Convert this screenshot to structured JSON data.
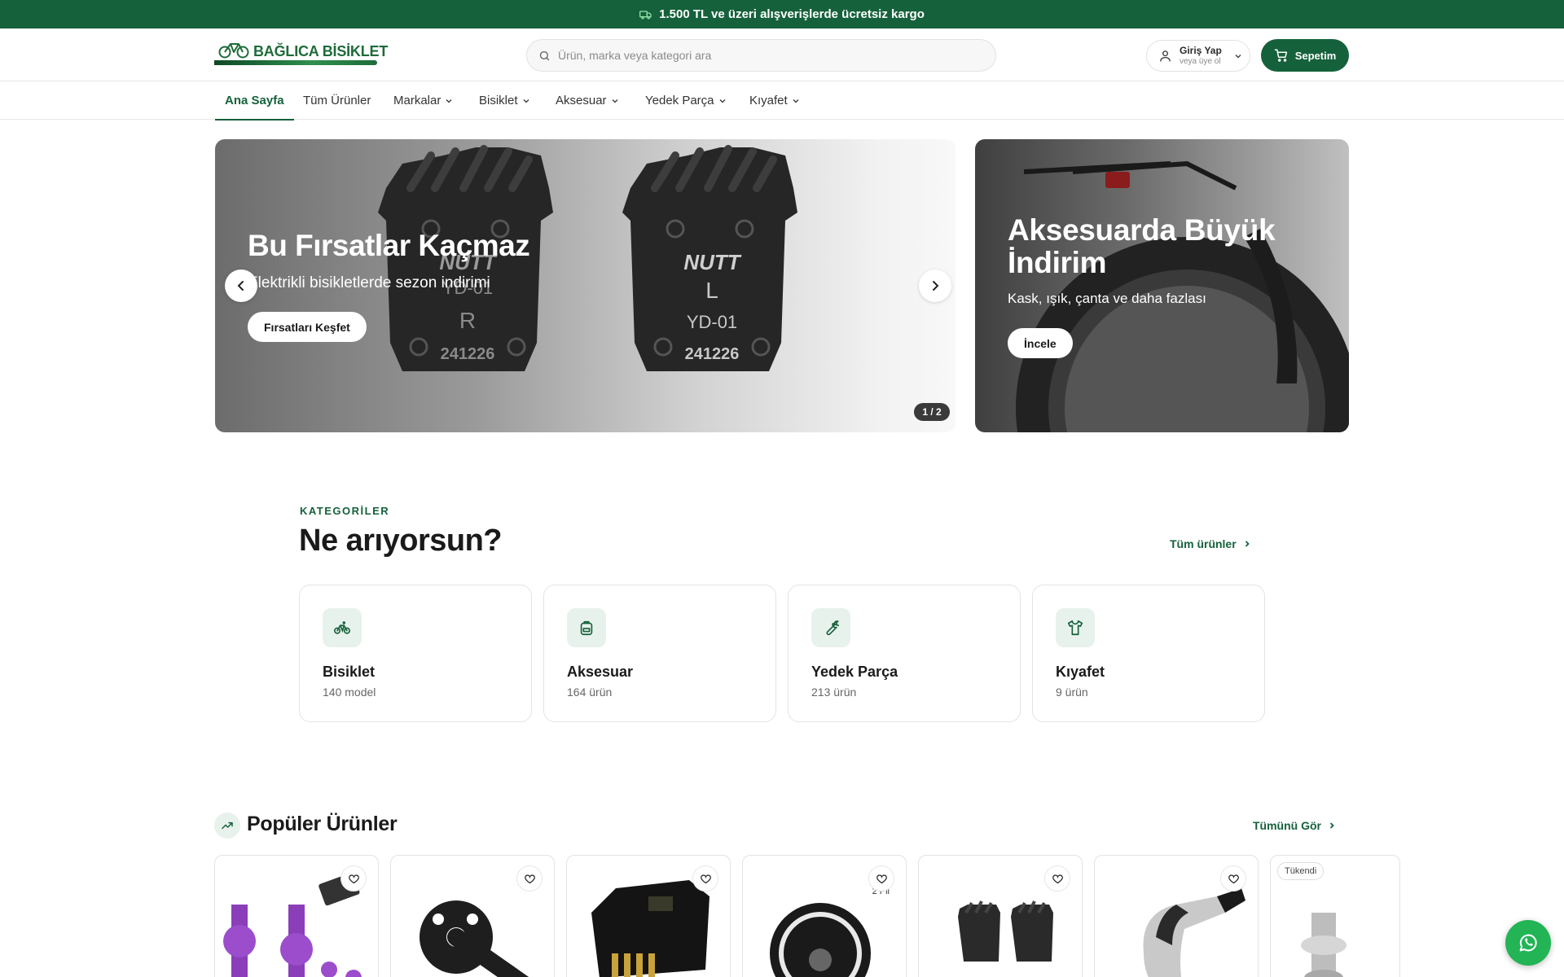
{
  "announcement": {
    "text": "1.500 TL ve üzeri alışverişlerde ücretsiz kargo",
    "icon": "truck-icon"
  },
  "header": {
    "logo_text": "BAĞLICA BİSİKLET",
    "search_placeholder": "Ürün, marka veya kategori ara",
    "login_label": "Giriş Yap",
    "login_sub": "veya üye ol",
    "cart_label": "Sepetim"
  },
  "nav": {
    "items": [
      {
        "label": "Ana Sayfa",
        "active": true,
        "dropdown": false
      },
      {
        "label": "Tüm Ürünler",
        "active": false,
        "dropdown": false
      },
      {
        "label": "Markalar",
        "active": false,
        "dropdown": true
      },
      {
        "label": "Bisiklet",
        "active": false,
        "dropdown": true
      },
      {
        "label": "Aksesuar",
        "active": false,
        "dropdown": true
      },
      {
        "label": "Yedek Parça",
        "active": false,
        "dropdown": true
      },
      {
        "label": "Kıyafet",
        "active": false,
        "dropdown": true
      }
    ]
  },
  "hero": {
    "title": "Bu Fırsatlar Kaçmaz",
    "subtitle": "Elektrikli bisikletlerde sezon indirimi",
    "button": "Fırsatları Keşfet",
    "counter": "1 / 2",
    "pad_left": {
      "brand": "NUTT",
      "code": "YD-01",
      "side": "R",
      "number": "241226"
    },
    "pad_right": {
      "brand": "NUTT",
      "code": "YD-01",
      "side": "L",
      "number": "241226"
    }
  },
  "hero2": {
    "title": "Aksesuarda Büyük İndirim",
    "subtitle": "Kask, ışık, çanta ve daha fazlası",
    "button": "İncele"
  },
  "categories": {
    "eyebrow": "KATEGORİLER",
    "title": "Ne arıyorsun?",
    "all_link": "Tüm ürünler",
    "items": [
      {
        "name": "Bisiklet",
        "count": "140 model",
        "icon": "bicycle-icon"
      },
      {
        "name": "Aksesuar",
        "count": "164 ürün",
        "icon": "backpack-icon"
      },
      {
        "name": "Yedek Parça",
        "count": "213 ürün",
        "icon": "wrench-icon"
      },
      {
        "name": "Kıyafet",
        "count": "9 ürün",
        "icon": "shirt-icon"
      }
    ]
  },
  "popular": {
    "title": "Popüler Ürünler",
    "see_all": "Tümünü Gör",
    "products": [
      {
        "image": "purple-hubs"
      },
      {
        "image": "crank-arm"
      },
      {
        "image": "battery-controller"
      },
      {
        "image": "headlight",
        "badge": "2 Pil"
      },
      {
        "image": "brake-pads"
      },
      {
        "image": "shifter"
      },
      {
        "image": "silver-hub",
        "badge": "Tükendi"
      }
    ]
  },
  "colors": {
    "brand_green": "#15613b",
    "whatsapp_green": "#22b455"
  }
}
